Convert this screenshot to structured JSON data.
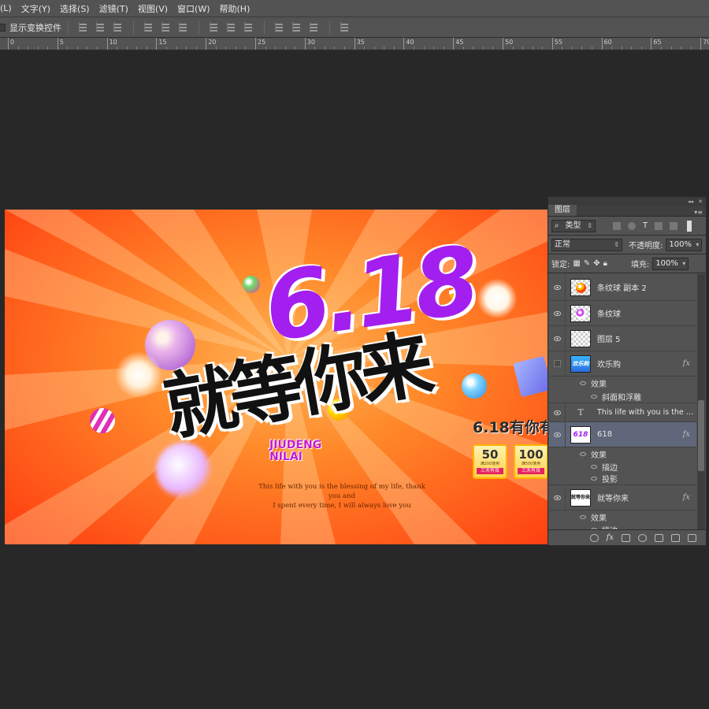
{
  "menubar": {
    "items": [
      "(L)",
      "文字(Y)",
      "选择(S)",
      "滤镜(T)",
      "视图(V)",
      "窗口(W)",
      "帮助(H)"
    ]
  },
  "options": {
    "show_transform_label": "显示变换控件"
  },
  "ruler": {
    "labels": [
      "0",
      "5",
      "10",
      "15",
      "20",
      "25",
      "30",
      "35",
      "40",
      "45",
      "50",
      "55",
      "60",
      "65",
      "70"
    ]
  },
  "artwork": {
    "title_number": "6.18",
    "title_cn": "就等你来",
    "pinyin_line1": "JIUDENG",
    "pinyin_line2": "NILAI",
    "tagline_line1": "This life with you is the blessing of my life, thank you and",
    "tagline_line2": "I spent every time, I will always love you",
    "promo_head": "6.18有你有",
    "coupons": [
      {
        "value": "50",
        "small": "满200使用",
        "band": "三天有效"
      },
      {
        "value": "100",
        "small": "满500使用",
        "band": "三天有效"
      }
    ],
    "accent_color": "#a31ff0",
    "bg_color": "#ff6a1a"
  },
  "panel": {
    "tab": "图层",
    "filter_kind": "类型",
    "blend_mode": "正常",
    "opacity_label": "不透明度:",
    "opacity_value": "100%",
    "lock_label": "锁定:",
    "fill_label": "填充:",
    "fill_value": "100%",
    "layers": [
      {
        "name": "条纹球 副本 2",
        "visible": true,
        "thumb": "orange-ball"
      },
      {
        "name": "条纹球",
        "visible": true,
        "thumb": "purple-ball"
      },
      {
        "name": "图层 5",
        "visible": true,
        "thumb": "empty"
      },
      {
        "name": "欢乐购",
        "visible": false,
        "thumb": "blue-text",
        "fx": "fx"
      },
      {
        "name": "This life with you is the b...",
        "visible": true,
        "thumb": "text-layer"
      },
      {
        "name": "618",
        "visible": true,
        "thumb": "618-text",
        "fx": "fx",
        "selected": true
      },
      {
        "name": "就等你来",
        "visible": true,
        "thumb": "cn-text",
        "fx": "fx"
      }
    ],
    "effects_label": "效果",
    "effect_bevel": "斜面和浮雕",
    "effect_stroke": "描边",
    "effect_shadow": "投影",
    "fx_symbol": "fx",
    "text_glyph": "T",
    "thumb_618": "618",
    "thumb_huanle": "欢乐购",
    "thumb_jiudeng": "就等你来"
  }
}
